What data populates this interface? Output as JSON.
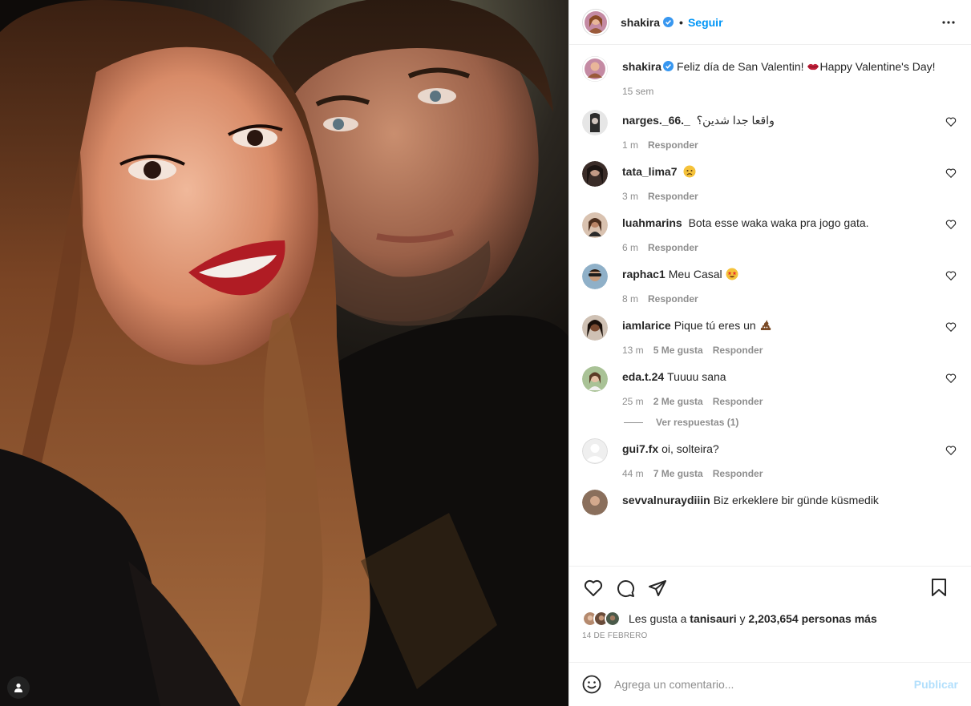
{
  "header": {
    "username": "shakira",
    "separator": "•",
    "follow_label": "Seguir"
  },
  "caption": {
    "username": "shakira",
    "text_part1": "Feliz día de San Valentin! ",
    "text_part2": "Happy Valentine's Day!",
    "time": "15 sem"
  },
  "comments": [
    {
      "username": "narges._66._",
      "text": "واقعا جدا شدین؟",
      "time": "1 m",
      "likes": "",
      "reply": "Responder",
      "avatar_color": "#3a3a3a"
    },
    {
      "username": "tata_lima7",
      "text": "",
      "emoji": "sad",
      "time": "3 m",
      "likes": "",
      "reply": "Responder",
      "avatar_color": "#5a4a44"
    },
    {
      "username": "luahmarins",
      "text": "Bota esse waka waka pra jogo gata.",
      "time": "6 m",
      "likes": "",
      "reply": "Responder",
      "avatar_color": "#a07a60"
    },
    {
      "username": "raphac1",
      "text": "Meu Casal",
      "emoji": "star-eyes",
      "time": "8 m",
      "likes": "",
      "reply": "Responder",
      "avatar_color": "#6b8aa3"
    },
    {
      "username": "iamlarice",
      "text": "Pique tú eres un",
      "emoji": "poop",
      "time": "13 m",
      "likes": "5 Me gusta",
      "reply": "Responder",
      "avatar_color": "#6d4a36"
    },
    {
      "username": "eda.t.24",
      "text": "Tuuuu sana",
      "time": "25 m",
      "likes": "2 Me gusta",
      "reply": "Responder",
      "avatar_color": "#7d9a6a"
    },
    {
      "username": "gui7.fx",
      "text": "oi, solteira?",
      "time": "44 m",
      "likes": "7 Me gusta",
      "reply": "Responder",
      "avatar_color": "#dbdbdb"
    },
    {
      "username": "sevvalnuraydiiin",
      "text": "Biz erkeklere bir günde küsmedik",
      "time": "",
      "likes": "",
      "reply": "",
      "avatar_color": "#8a6f5c"
    }
  ],
  "view_replies": "Ver respuestas (1)",
  "likes": {
    "prefix": "Les gusta a ",
    "user": "tanisauri",
    "middle": " y ",
    "count": "2,203,654 personas más"
  },
  "date": "14 DE FEBRERO",
  "add_comment": {
    "placeholder": "Agrega un comentario...",
    "publish_label": "Publicar"
  },
  "colors": {
    "accent": "#0095f6",
    "publish_disabled": "#b2dffc",
    "muted": "#8e8e8e",
    "verified": "#3897f0",
    "heart_lips": "#c2213b"
  }
}
